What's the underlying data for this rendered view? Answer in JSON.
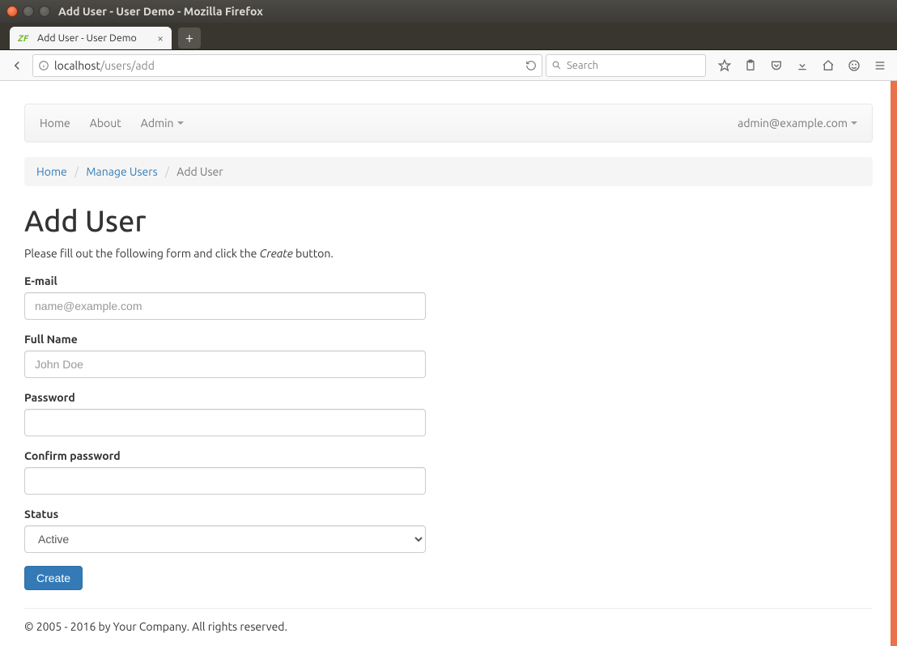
{
  "window": {
    "title": "Add User - User Demo - Mozilla Firefox"
  },
  "tab": {
    "title": "Add User - User Demo"
  },
  "url": {
    "host": "localhost",
    "path": "/users/add"
  },
  "searchbox": {
    "placeholder": "Search"
  },
  "navbar": {
    "items": [
      {
        "label": "Home"
      },
      {
        "label": "About"
      },
      {
        "label": "Admin",
        "dropdown": true
      }
    ],
    "user": "admin@example.com"
  },
  "breadcrumb": {
    "items": [
      {
        "label": "Home",
        "link": true
      },
      {
        "label": "Manage Users",
        "link": true
      },
      {
        "label": "Add User",
        "link": false
      }
    ]
  },
  "page": {
    "heading": "Add User",
    "intro_before": "Please fill out the following form and click the ",
    "intro_em": "Create",
    "intro_after": " button."
  },
  "form": {
    "email_label": "E-mail",
    "email_placeholder": "name@example.com",
    "email_value": "",
    "fullname_label": "Full Name",
    "fullname_placeholder": "John Doe",
    "fullname_value": "",
    "password_label": "Password",
    "password_value": "",
    "confirm_label": "Confirm password",
    "confirm_value": "",
    "status_label": "Status",
    "status_selected": "Active",
    "submit_label": "Create"
  },
  "footer": {
    "text": "© 2005 - 2016 by Your Company. All rights reserved."
  }
}
